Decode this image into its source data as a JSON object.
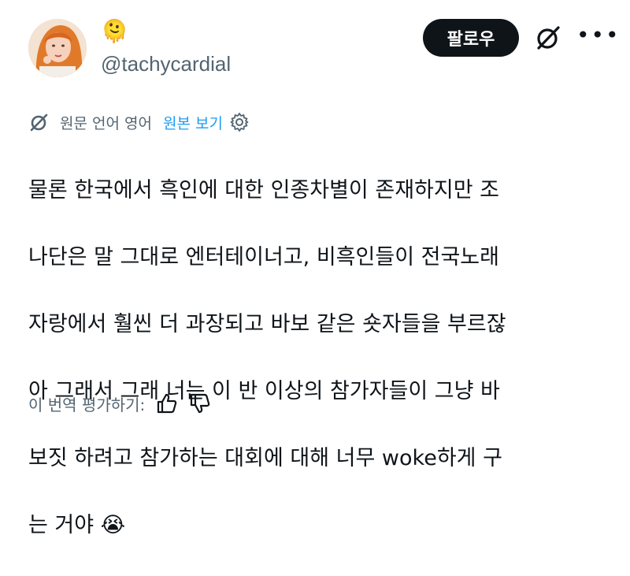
{
  "profile": {
    "display_name": "🫠",
    "handle": "@tachycardial",
    "follow_label": "팔로우",
    "more_label": "•••"
  },
  "translation": {
    "label": "원문 언어 영어",
    "show_original": "원본 보기"
  },
  "tweet": {
    "lines": [
      "물론 한국에서 흑인에 대한 인종차별이 존재하지만 조",
      "나단은 말 그대로 엔터테이너고, 비흑인들이 전국노래",
      "자랑에서 훨씬 더 과장되고 바보 같은 숏자들을 부르잖",
      "아 그래서 그래 너는 이 반 이상의 참가자들이 그냥 바",
      "보짓 하려고 참가하는 대회에 대해 너무 woke하게 구",
      "는 거야 😭"
    ]
  },
  "rating": {
    "label": "이 번역 평가하기:"
  },
  "colors": {
    "accent": "#1d9bf0",
    "text": "#0f1419",
    "muted": "#536471",
    "button_bg": "#0f1419"
  }
}
